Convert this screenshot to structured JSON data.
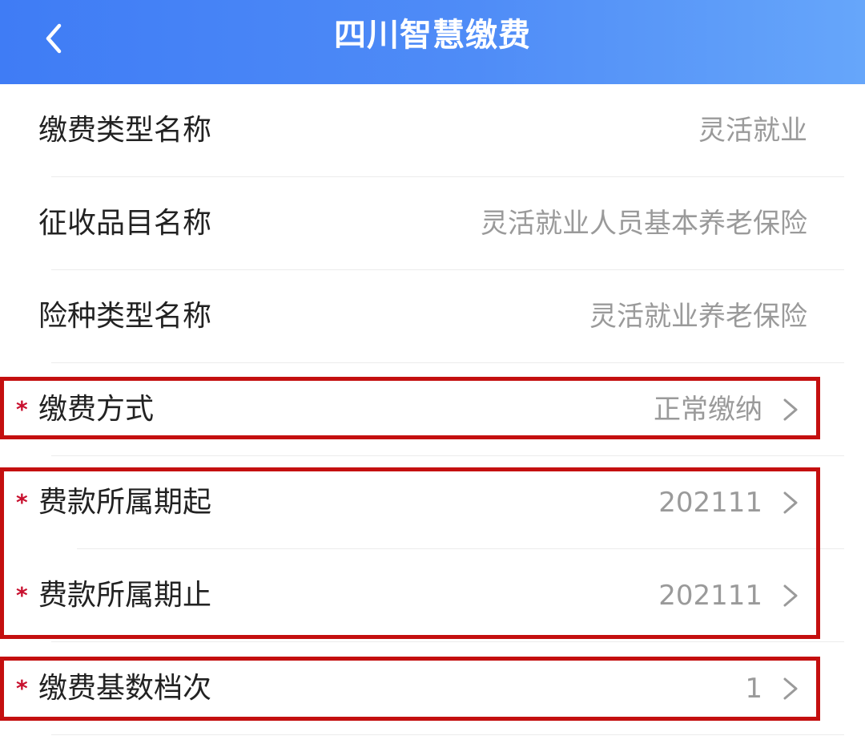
{
  "header": {
    "title": "四川智慧缴费",
    "back_icon": "chevron-left-icon"
  },
  "rows": [
    {
      "label": "缴费类型名称",
      "value": "灵活就业",
      "required": false,
      "has_arrow": false
    },
    {
      "label": "征收品目名称",
      "value": "灵活就业人员基本养老保险",
      "required": false,
      "has_arrow": false
    },
    {
      "label": "险种类型名称",
      "value": "灵活就业养老保险",
      "required": false,
      "has_arrow": false
    },
    {
      "label": "缴费方式",
      "value": "正常缴纳",
      "required": true,
      "has_arrow": true
    },
    {
      "label": "费款所属期起",
      "value": "202111",
      "required": true,
      "has_arrow": true
    },
    {
      "label": "费款所属期止",
      "value": "202111",
      "required": true,
      "has_arrow": true
    },
    {
      "label": "缴费基数档次",
      "value": "1",
      "required": true,
      "has_arrow": true
    }
  ],
  "required_mark": "*",
  "colors": {
    "header_gradient_start": "#3f7cf5",
    "header_gradient_end": "#66a6fa",
    "highlight_box": "#c40f0f",
    "required_mark": "#c8102e",
    "label_text": "#222222",
    "value_text": "#9a9a9a"
  }
}
